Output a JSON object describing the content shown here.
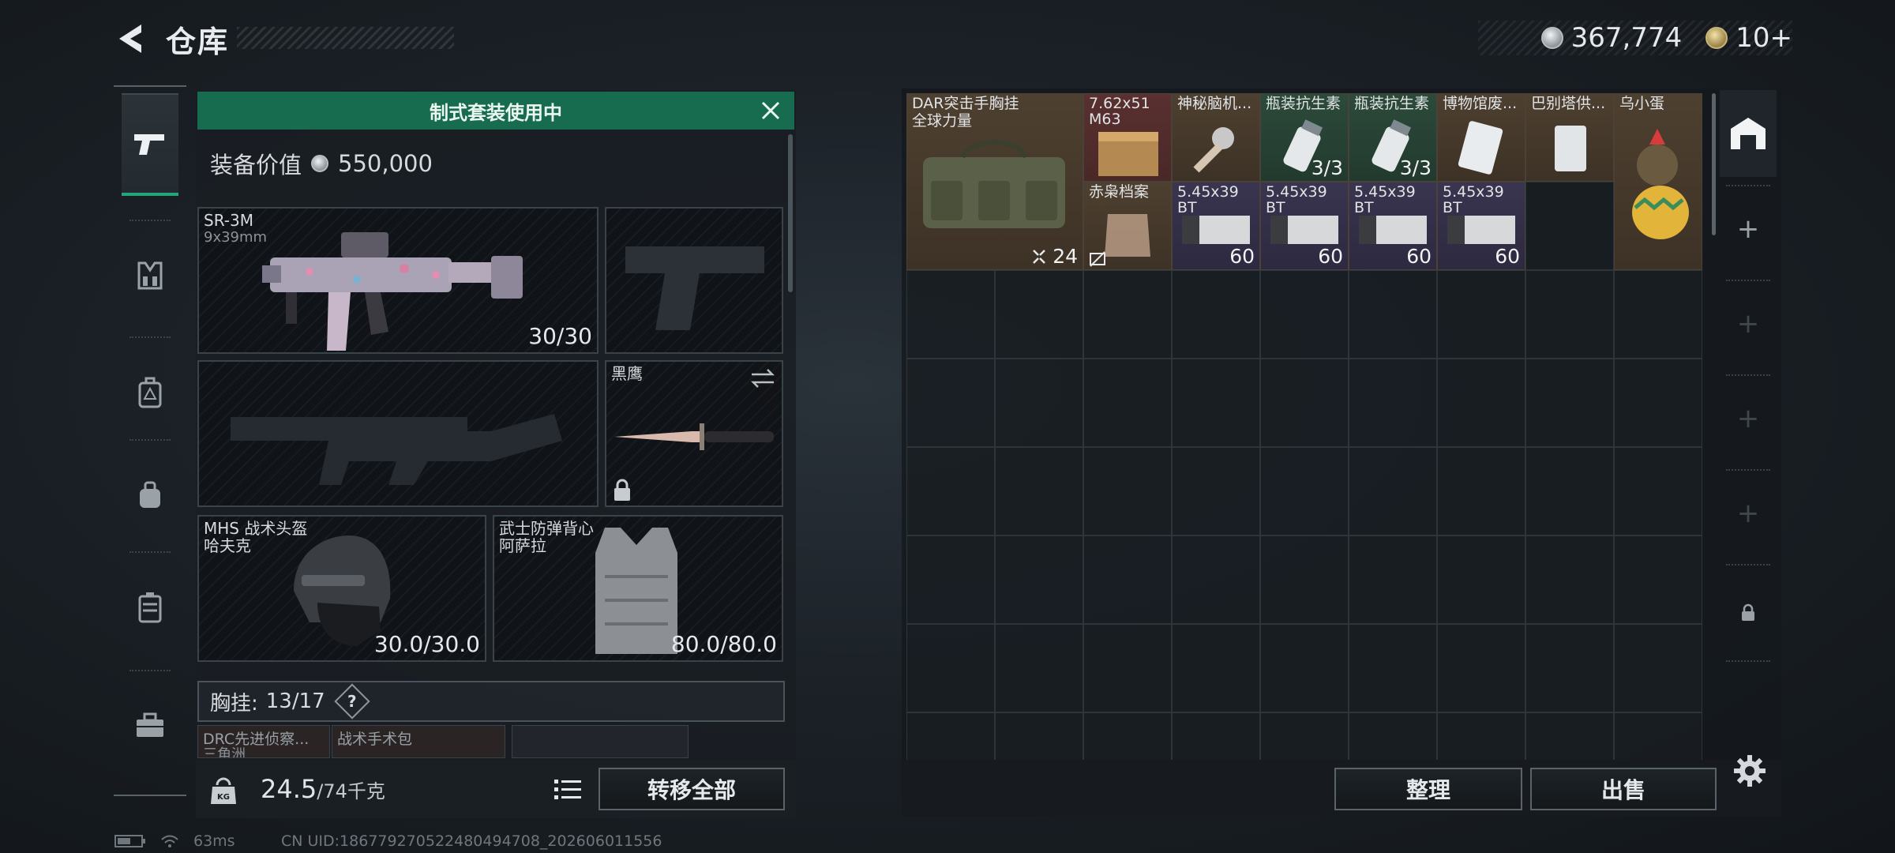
{
  "header": {
    "title": "仓库",
    "currency": {
      "silver": "367,774",
      "gold": "10+"
    }
  },
  "left_rail": {
    "items": [
      {
        "icon": "pistol-icon",
        "active": true
      },
      {
        "icon": "chest-rig-icon",
        "active": false
      },
      {
        "icon": "backpack-icon",
        "active": false
      },
      {
        "icon": "pouch-icon",
        "active": false
      },
      {
        "icon": "vest-icon",
        "active": false
      },
      {
        "icon": "toolbox-icon",
        "active": false
      }
    ]
  },
  "loadout": {
    "banner": "制式套装使用中",
    "value_label": "装备价值",
    "value": "550,000",
    "primary": {
      "name": "SR-3M",
      "caliber": "9x39mm",
      "ammo": "30/30"
    },
    "melee": {
      "name": "黑鹰"
    },
    "helmet": {
      "name": "MHS 战术头盔",
      "variant": "哈夫克",
      "durability": "30.0/30.0"
    },
    "armor": {
      "name": "武士防弹背心",
      "variant": "阿萨拉",
      "durability": "80.0/80.0"
    },
    "chest": {
      "label": "胸挂:",
      "capacity": "13/17",
      "help": "?"
    },
    "mini_items": [
      {
        "label": "DRC先进侦察...",
        "sub": "三角洲"
      },
      {
        "label": "战术手术包",
        "sub": ""
      },
      {
        "label": "",
        "sub": ""
      }
    ],
    "weight": {
      "current": "24.5",
      "max": "/74千克"
    },
    "transfer_all": "转移全部"
  },
  "storage": {
    "items": [
      {
        "name": "DAR突击手胸挂",
        "sub": "全球力量",
        "count": "24"
      },
      {
        "name": "7.62x51",
        "sub": "M63",
        "count": ""
      },
      {
        "name": "神秘脑机...",
        "sub": "",
        "count": ""
      },
      {
        "name": "瓶装抗生素",
        "sub": "",
        "count": "3/3"
      },
      {
        "name": "瓶装抗生素",
        "sub": "",
        "count": "3/3"
      },
      {
        "name": "博物馆废...",
        "sub": "",
        "count": ""
      },
      {
        "name": "巴别塔供...",
        "sub": "",
        "count": ""
      },
      {
        "name": "乌小蛋",
        "sub": "",
        "count": ""
      },
      {
        "name": "赤枭档案",
        "sub": "",
        "count": ""
      },
      {
        "name": "5.45x39",
        "sub": "BT",
        "count": "60"
      },
      {
        "name": "5.45x39",
        "sub": "BT",
        "count": "60"
      },
      {
        "name": "5.45x39",
        "sub": "BT",
        "count": "60"
      },
      {
        "name": "5.45x39",
        "sub": "BT",
        "count": "60"
      }
    ],
    "organize": "整理",
    "sell": "出售"
  },
  "status": {
    "ping": "63ms",
    "uid": "CN UID:186779270522480494708_202606011556"
  },
  "colors": {
    "accent_green": "#176c4f",
    "rail_active": "#27a57a"
  }
}
